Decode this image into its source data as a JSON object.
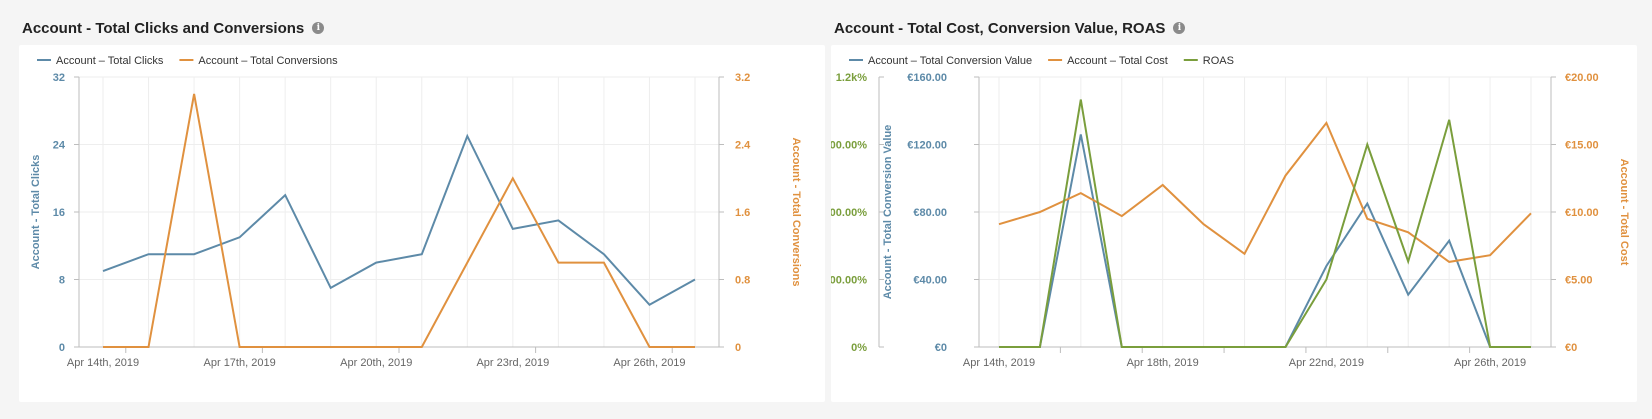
{
  "panels": [
    {
      "title": "Account - Total Clicks and Conversions",
      "info_icon": "info-icon"
    },
    {
      "title": "Account - Total Cost, Conversion Value, ROAS",
      "info_icon": "info-icon"
    }
  ],
  "colors": {
    "blue": "#5d8aa8",
    "orange": "#e0913f",
    "green": "#7a9e3c",
    "axis_gray": "#bdbdbd",
    "grid": "#eeeeee",
    "tick_text": "#666666"
  },
  "chart_data": [
    {
      "type": "line",
      "x": [
        "Apr 14th, 2019",
        "Apr 15th, 2019",
        "Apr 16th, 2019",
        "Apr 17th, 2019",
        "Apr 18th, 2019",
        "Apr 19th, 2019",
        "Apr 20th, 2019",
        "Apr 21st, 2019",
        "Apr 22nd, 2019",
        "Apr 23rd, 2019",
        "Apr 24th, 2019",
        "Apr 25th, 2019",
        "Apr 26th, 2019",
        "Apr 27th, 2019"
      ],
      "x_tick_labels": [
        "Apr 14th, 2019",
        "Apr 17th, 2019",
        "Apr 20th, 2019",
        "Apr 23rd, 2019",
        "Apr 26th, 2019"
      ],
      "legend": [
        "Account – Total Clicks",
        "Account – Total Conversions"
      ],
      "series": [
        {
          "name": "Account - Total Clicks",
          "axis": "left",
          "color": "#5d8aa8",
          "values": [
            9,
            11,
            11,
            13,
            18,
            7,
            10,
            11,
            25,
            14,
            15,
            11,
            5,
            8
          ]
        },
        {
          "name": "Account - Total Conversions",
          "axis": "right",
          "color": "#e0913f",
          "values": [
            0,
            0,
            3,
            0,
            0,
            0,
            0,
            0,
            1,
            2,
            1,
            1,
            0,
            0
          ]
        }
      ],
      "y_left": {
        "label": "Account - Total Clicks",
        "ticks": [
          "0",
          "8",
          "16",
          "24",
          "32"
        ],
        "ylim": [
          0,
          32
        ]
      },
      "y_right": {
        "label": "Account - Total Conversions",
        "ticks": [
          "0",
          "0.8",
          "1.6",
          "2.4",
          "3.2"
        ],
        "ylim": [
          0,
          3.2
        ]
      },
      "legend_position": "top-left",
      "grid": true
    },
    {
      "type": "line",
      "x": [
        "Apr 14th, 2019",
        "Apr 15th, 2019",
        "Apr 16th, 2019",
        "Apr 17th, 2019",
        "Apr 18th, 2019",
        "Apr 19th, 2019",
        "Apr 20th, 2019",
        "Apr 21st, 2019",
        "Apr 22nd, 2019",
        "Apr 23rd, 2019",
        "Apr 24th, 2019",
        "Apr 25th, 2019",
        "Apr 26th, 2019",
        "Apr 27th, 2019"
      ],
      "x_tick_labels": [
        "Apr 14th, 2019",
        "Apr 18th, 2019",
        "Apr 22nd, 2019",
        "Apr 26th, 2019"
      ],
      "legend": [
        "Account – Total Conversion Value",
        "Account – Total Cost",
        "ROAS"
      ],
      "series": [
        {
          "name": "Account - Total Conversion Value",
          "axis": "left_inner",
          "color": "#5d8aa8",
          "values": [
            0,
            0,
            126,
            0,
            0,
            0,
            0,
            0,
            48,
            85,
            31,
            63,
            0,
            0
          ]
        },
        {
          "name": "Account - Total Cost",
          "axis": "right",
          "color": "#e0913f",
          "values": [
            9.1,
            10.0,
            11.4,
            9.7,
            12.0,
            9.1,
            6.9,
            12.7,
            16.6,
            9.5,
            8.5,
            6.3,
            6.8,
            9.9
          ]
        },
        {
          "name": "ROAS",
          "axis": "left_outer",
          "color": "#7a9e3c",
          "values": [
            0,
            0,
            1100,
            0,
            0,
            0,
            0,
            0,
            300,
            900,
            380,
            1010,
            0,
            0
          ]
        }
      ],
      "y_left_outer": {
        "label": "ROAS",
        "ticks": [
          "0%",
          "300.00%",
          "600.00%",
          "900.00%",
          "1.2k%"
        ],
        "ylim": [
          0,
          1200
        ]
      },
      "y_left_inner": {
        "label": "Account - Total Conversion Value",
        "ticks": [
          "€0",
          "€40.00",
          "€80.00",
          "€120.00",
          "€160.00"
        ],
        "ylim": [
          0,
          160
        ]
      },
      "y_right": {
        "label": "Account - Total Cost",
        "ticks": [
          "€0",
          "€5.00",
          "€10.00",
          "€15.00",
          "€20.00"
        ],
        "ylim": [
          0,
          20
        ]
      },
      "legend_position": "top-left",
      "grid": true
    }
  ]
}
